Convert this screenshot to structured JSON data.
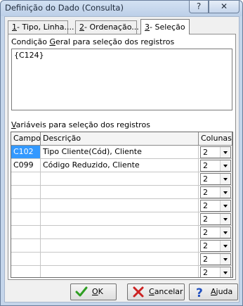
{
  "window": {
    "title": "Definição do Dado (Consulta)",
    "help_glyph": "?",
    "close_glyph": "✕"
  },
  "tabs": [
    {
      "key": "1",
      "label": "- Tipo, Linha...."
    },
    {
      "key": "2",
      "label": "- Ordenação..."
    },
    {
      "key": "3",
      "label": "- Seleção",
      "active": true
    }
  ],
  "condition": {
    "label_pre": "Condição ",
    "label_accel": "G",
    "label_post": "eral para seleção dos registros",
    "value": "{C124}"
  },
  "variables": {
    "label_accel": "V",
    "label_post": "ariáveis para seleção dos registros",
    "headers": {
      "campo": "Campo",
      "descricao": "Descrição",
      "colunas": "Colunas"
    },
    "rows": [
      {
        "campo": "C102",
        "descricao": "Tipo Cliente(Cód), Cliente",
        "colunas": "2"
      },
      {
        "campo": "C099",
        "descricao": "Código Reduzido, Cliente",
        "colunas": "2"
      },
      {
        "campo": "",
        "descricao": "",
        "colunas": "2"
      },
      {
        "campo": "",
        "descricao": "",
        "colunas": "2"
      },
      {
        "campo": "",
        "descricao": "",
        "colunas": "2"
      },
      {
        "campo": "",
        "descricao": "",
        "colunas": "2"
      },
      {
        "campo": "",
        "descricao": "",
        "colunas": "2"
      },
      {
        "campo": "",
        "descricao": "",
        "colunas": "2"
      },
      {
        "campo": "",
        "descricao": "",
        "colunas": "2"
      },
      {
        "campo": "",
        "descricao": "",
        "colunas": "2"
      }
    ]
  },
  "buttons": {
    "ok": {
      "accel": "O",
      "rest": "K",
      "icon": "checkmark-icon",
      "color": "#2e9e22"
    },
    "cancel": {
      "accel": "C",
      "rest": "ancelar",
      "icon": "x-icon",
      "color": "#cc2222"
    },
    "help": {
      "accel": "A",
      "rest": "juda",
      "icon": "question-icon",
      "color": "#1f4fbf"
    }
  },
  "colors": {
    "selection": "#3399ff",
    "titlebar": "#c4d5ea"
  }
}
